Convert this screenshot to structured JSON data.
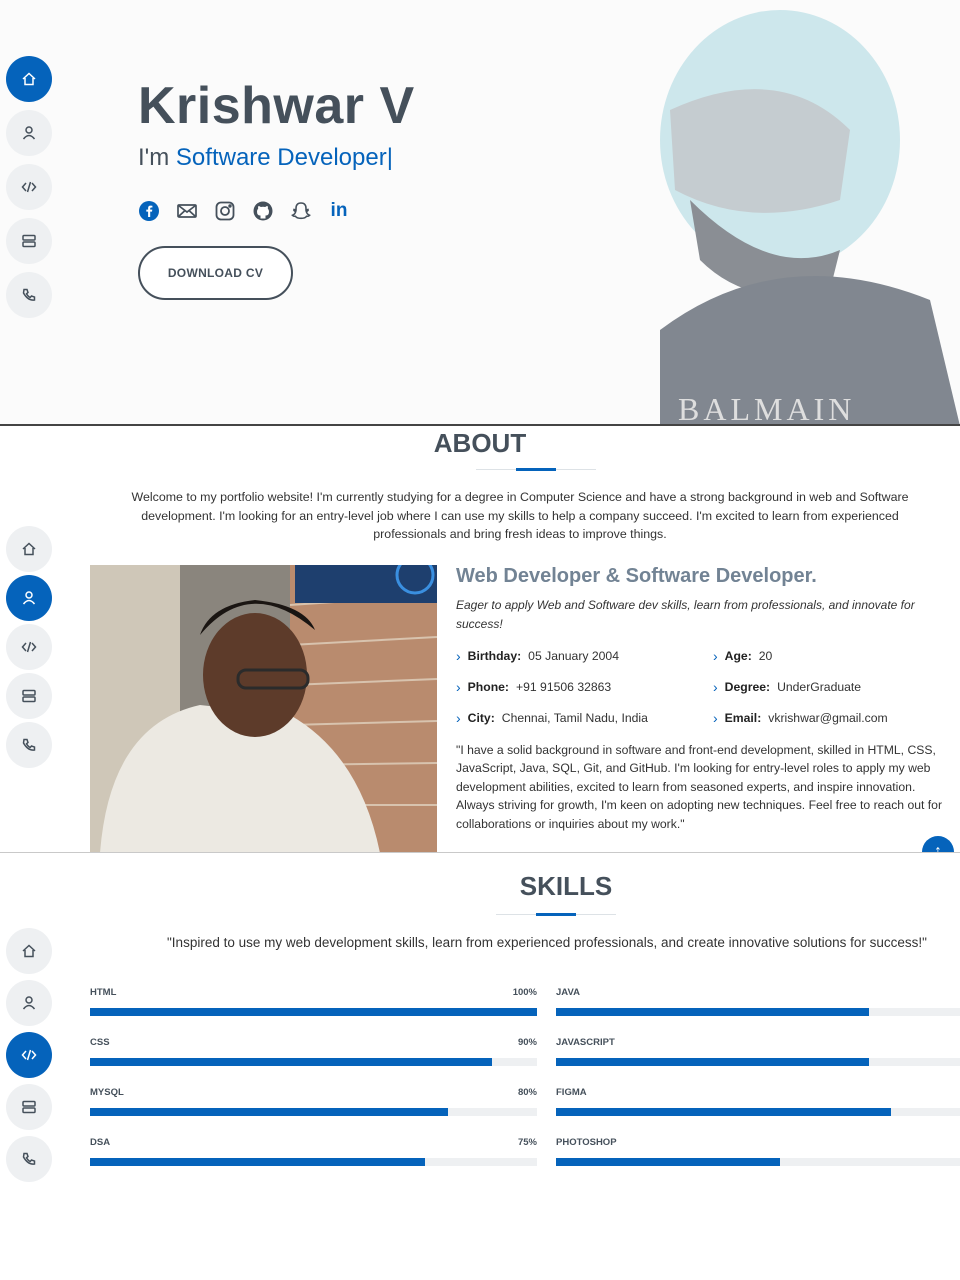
{
  "nav": {
    "items": [
      {
        "icon": "home-icon"
      },
      {
        "icon": "user-icon"
      },
      {
        "icon": "code-icon"
      },
      {
        "icon": "server-icon"
      },
      {
        "icon": "phone-icon"
      }
    ]
  },
  "hero": {
    "name": "Krishwar V",
    "prefix": "I'm ",
    "typed": "Software Developer",
    "cursor": "|",
    "social": [
      "facebook-icon",
      "envelope-icon",
      "instagram-icon",
      "github-icon",
      "snapchat-icon",
      "linkedin-icon"
    ],
    "linkedin_text": "in",
    "cv_button": "DOWNLOAD CV",
    "shirt_text": "BALMAIN"
  },
  "about": {
    "title": "ABOUT",
    "intro": "Welcome to my portfolio website! I'm currently studying for a degree in Computer Science and have a strong background in web and Software development. I'm looking for an entry-level job where I can use my skills to help a company succeed. I'm excited to learn from experienced professionals and bring fresh ideas to improve things.",
    "heading": "Web Developer & Software Developer.",
    "tagline": "Eager to apply Web and Software dev skills, learn from professionals, and innovate for success!",
    "facts": [
      {
        "label": "Birthday:",
        "value": "05 January 2004"
      },
      {
        "label": "Age:",
        "value": "20"
      },
      {
        "label": "Phone:",
        "value": "+91 91506 32863"
      },
      {
        "label": "Degree:",
        "value": "UnderGraduate"
      },
      {
        "label": "City:",
        "value": "Chennai, Tamil Nadu, India"
      },
      {
        "label": "Email:",
        "value": "vkrishwar@gmail.com"
      }
    ],
    "quote": "\"I have a solid background in software and front-end development, skilled in HTML, CSS, JavaScript, Java, SQL, Git, and GitHub. I'm looking for entry-level roles to apply my web development abilities, excited to learn from seasoned experts, and inspire innovation. Always striving for growth, I'm keen on adopting new techniques. Feel free to reach out for collaborations or inquiries about my work.\"",
    "back_to_top": "↑"
  },
  "skills": {
    "title": "SKILLS",
    "intro": "\"Inspired to use my web development skills, learn from experienced professionals, and create innovative solutions for success!\"",
    "left": [
      {
        "name": "HTML",
        "label": "100%",
        "value": 100
      },
      {
        "name": "CSS",
        "label": "90%",
        "value": 90
      },
      {
        "name": "MYSQL",
        "label": "80%",
        "value": 80
      },
      {
        "name": "DSA",
        "label": "75%",
        "value": 75
      }
    ],
    "right": [
      {
        "name": "JAVA",
        "value": 70
      },
      {
        "name": "JAVASCRIPT",
        "value": 70
      },
      {
        "name": "FIGMA",
        "value": 75
      },
      {
        "name": "PHOTOSHOP",
        "value": 50
      }
    ]
  },
  "colors": {
    "accent": "#0563bb",
    "text": "#45505b",
    "muted": "#728394"
  }
}
